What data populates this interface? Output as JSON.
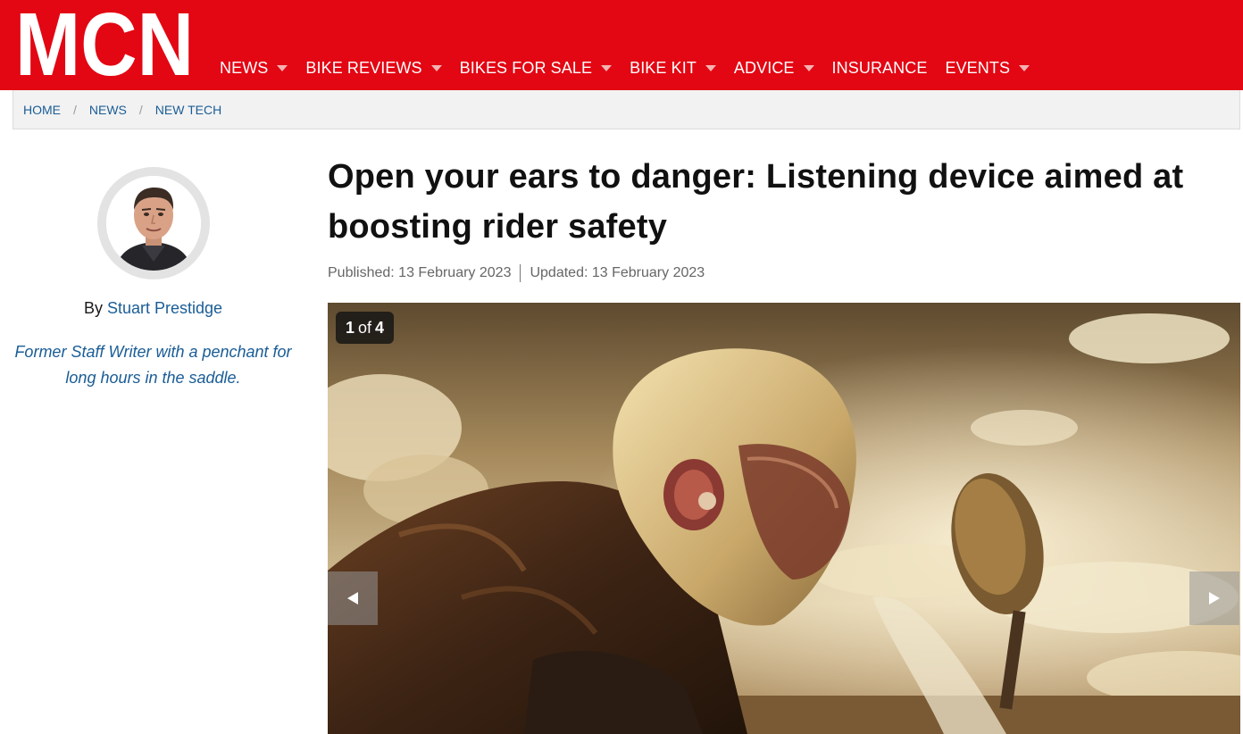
{
  "header": {
    "logo_text": "MCN",
    "colors": {
      "brand_red": "#e30613",
      "link_blue": "#1a5d96"
    },
    "nav": [
      {
        "label": "NEWS",
        "has_dropdown": true,
        "icon": "caret-down-icon"
      },
      {
        "label": "BIKE REVIEWS",
        "has_dropdown": true,
        "icon": "caret-down-icon"
      },
      {
        "label": "BIKES FOR SALE",
        "has_dropdown": true,
        "icon": "caret-down-icon"
      },
      {
        "label": "BIKE KIT",
        "has_dropdown": true,
        "icon": "caret-down-icon"
      },
      {
        "label": "ADVICE",
        "has_dropdown": true,
        "icon": "caret-down-icon"
      },
      {
        "label": "INSURANCE",
        "has_dropdown": false
      },
      {
        "label": "EVENTS",
        "has_dropdown": true,
        "icon": "caret-down-icon"
      }
    ]
  },
  "breadcrumb": {
    "items": [
      "HOME",
      "NEWS",
      "NEW TECH"
    ],
    "separator": "/"
  },
  "author": {
    "by_label": "By",
    "name": "Stuart Prestidge",
    "bio": "Former Staff Writer with a penchant for long hours in the saddle."
  },
  "article": {
    "headline": "Open your ears to danger: Listening device aimed at boosting rider safety",
    "published": "Published: 13 February 2023",
    "updated": "Updated: 13 February 2023"
  },
  "gallery": {
    "current": "1",
    "of_label": "of",
    "total": "4",
    "prev_icon": "triangle-left-icon",
    "next_icon": "triangle-right-icon"
  }
}
